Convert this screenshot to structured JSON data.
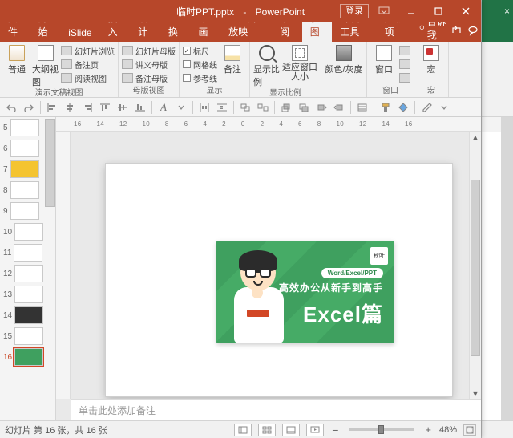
{
  "title": {
    "filename": "临时PPT.pptx",
    "app": "PowerPoint",
    "login": "登录"
  },
  "wincontrols": {
    "help": "?"
  },
  "tabs": [
    "文件",
    "开始",
    "iSlide",
    "插入",
    "设计",
    "切换",
    "动画",
    "幻灯片放映",
    "审阅",
    "视图",
    "开发工具",
    "加载项"
  ],
  "activeTab": 9,
  "tell": "告诉我",
  "ribbon": {
    "g1": {
      "label": "演示文稿视图",
      "normal": "普通",
      "outline": "大纲视图",
      "c1": "幻灯片浏览",
      "c2": "备注页",
      "c3": "阅读视图"
    },
    "g2": {
      "label": "母版视图",
      "c1": "幻灯片母版",
      "c2": "讲义母版",
      "c3": "备注母版"
    },
    "g3": {
      "label": "显示",
      "c1": "标尺",
      "c2": "网格线",
      "c3": "参考线",
      "notes": "备注"
    },
    "g4": {
      "label": "显示比例",
      "zoom": "显示比例",
      "fit": "适应窗口大小"
    },
    "g5": {
      "label": "",
      "gray": "颜色/灰度"
    },
    "g6": {
      "label": "窗口",
      "win": "窗口"
    },
    "g7": {
      "label": "宏",
      "macro": "宏"
    }
  },
  "ruler": "16 · · · 14 · · · 12 · · · 10 · · · 8 · · · 6 · · · 4 · · · 2 · · · 0 · · · 2 · · · 4 · · · 6 · · · 8 · · · 10 · · · 12 · · · 14 · · · 16 · ·",
  "notes_placeholder": "单击此处添加备注",
  "status": {
    "left": "幻灯片 第 16 张，共 16 张",
    "lang": "",
    "zoom": "48%"
  },
  "slide": {
    "pill": "Word/Excel/PPT",
    "line1": "高效办公从新手到高手",
    "line2": "Excel篇",
    "badge": "秋叶"
  },
  "thumbs": [
    5,
    6,
    7,
    8,
    9,
    10,
    11,
    12,
    13,
    14,
    15,
    16
  ],
  "current": 16,
  "excel": {
    "close": "×"
  }
}
